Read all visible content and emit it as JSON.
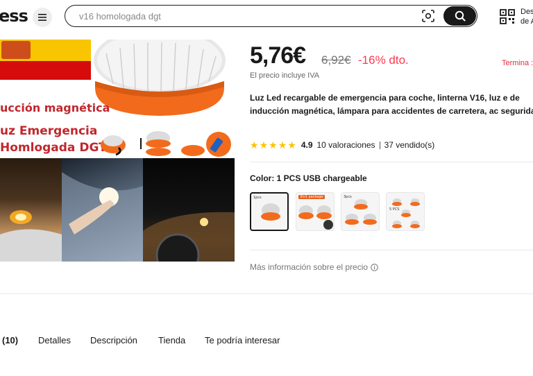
{
  "header": {
    "logo_text": "ess",
    "search_placeholder": "v16 homologada dgt",
    "app_text_line1": "Des",
    "app_text_line2": "de A"
  },
  "gallery": {
    "promo_line1": "ucción magnética",
    "promo_line2": "uz Emergencia",
    "promo_line3": " Homlogada DGT"
  },
  "price": {
    "current": "5,76€",
    "original": "6,92€",
    "discount": "-16% dto.",
    "ends_label": "Termina :",
    "vat_note": "El precio incluye IVA"
  },
  "product": {
    "title": "Luz Led recargable de emergencia para coche, linterna V16, luz e de inducción magnética, lámpara para accidentes de carretera, ac seguridad"
  },
  "rating": {
    "score": "4.9",
    "reviews": "10 valoraciones",
    "sold": "37 vendido(s)",
    "stars": 5
  },
  "variant": {
    "label": "Color: ",
    "selected": "1 PCS USB chargeable",
    "options": [
      {
        "tag": "1pcs"
      },
      {
        "tag": "3in1 package"
      },
      {
        "tag": "3pcs"
      },
      {
        "tag": "5 PCS"
      }
    ]
  },
  "more_info": "Más información sobre el precio",
  "tabs": {
    "reviews": " (10)",
    "details": "Detalles",
    "description": "Descripción",
    "store": "Tienda",
    "related": "Te podría interesar"
  },
  "colors": {
    "accent_red": "#fd384f",
    "star_yellow": "#f9c400",
    "product_orange": "#f26b1d"
  }
}
